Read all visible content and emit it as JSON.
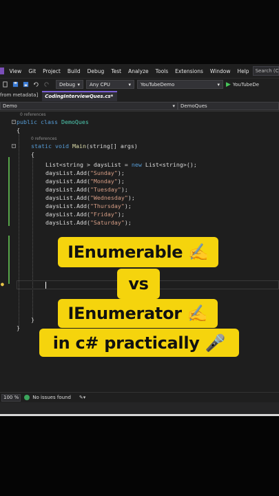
{
  "menubar": {
    "items": [
      "View",
      "Git",
      "Project",
      "Build",
      "Debug",
      "Test",
      "Analyze",
      "Tools",
      "Extensions",
      "Window",
      "Help"
    ],
    "search_placeholder": "Search (C"
  },
  "toolbar": {
    "config": "Debug",
    "platform": "Any CPU",
    "project": "YouTubeDemo",
    "run_label": "YouTubeDe"
  },
  "tabs": {
    "left": "from metadata]",
    "active": "CodingInterviewQues.cs*"
  },
  "navbar": {
    "left": "Demo",
    "right": "DemoQues"
  },
  "editor": {
    "references": "0 references",
    "class_kw": "public class",
    "class_name": "DemoQues",
    "open_brace": "{",
    "method_kw": "static void",
    "method_name": "Main",
    "method_args": "(string[] args)",
    "decl_prefix": "List<string > daysList = ",
    "decl_new": "new",
    "decl_suffix": " List<string>();",
    "add_call": "daysList.Add(",
    "days": [
      "\"Sunday\"",
      "\"Monday\"",
      "\"Tuesday\"",
      "\"Wednesday\"",
      "\"Thursday\"",
      "\"Friday\"",
      "\"Saturday\""
    ],
    "close_call": ");",
    "close_brace": "}"
  },
  "statusbar": {
    "zoom": "100 %",
    "issues": "No issues found"
  },
  "overlay": {
    "line1": "IEnumerable ✍️",
    "line2": "vs",
    "line3": "IEnumerator ✍️",
    "line4": "in c# practically 🎤"
  },
  "colors": {
    "banner": "#f5d40d",
    "editor_bg": "#1e1e1e",
    "keyword": "#569cd6",
    "type": "#4ec9b0",
    "string": "#d69d85"
  }
}
